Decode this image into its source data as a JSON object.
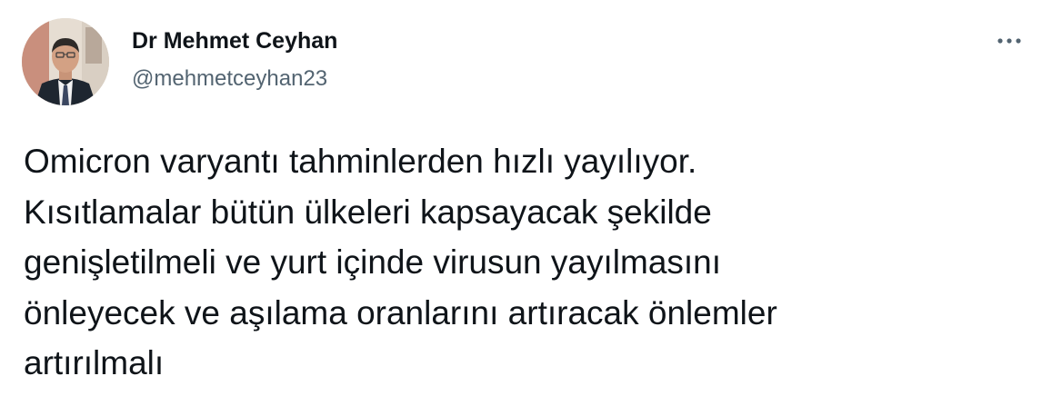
{
  "tweet": {
    "author_name": "Dr Mehmet Ceyhan",
    "author_handle": "@mehmetceyhan23",
    "avatar_icon": "profile-photo",
    "more_icon": "more-options-icon",
    "text_lines": [
      "Omicron varyantı tahminlerden hızlı yayılıyor.",
      "Kısıtlamalar bütün ülkeleri kapsayacak şekilde",
      "genişletilmeli ve yurt içinde virusun yayılmasını",
      "önleyecek ve aşılama oranlarını artıracak önlemler",
      "artırılmalı"
    ]
  }
}
